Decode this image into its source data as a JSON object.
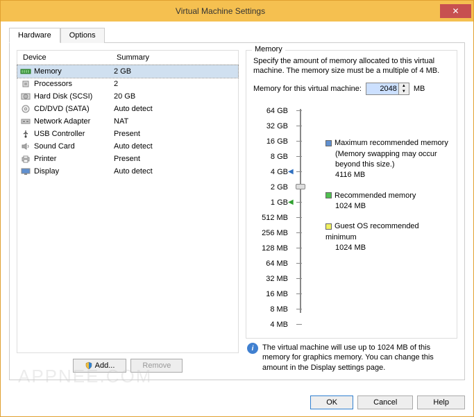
{
  "window": {
    "title": "Virtual Machine Settings"
  },
  "tabs": {
    "hardware": "Hardware",
    "options": "Options"
  },
  "deviceList": {
    "headers": {
      "device": "Device",
      "summary": "Summary"
    },
    "rows": [
      {
        "name": "Memory",
        "summary": "2 GB",
        "icon": "memory"
      },
      {
        "name": "Processors",
        "summary": "2",
        "icon": "cpu"
      },
      {
        "name": "Hard Disk (SCSI)",
        "summary": "20 GB",
        "icon": "disk"
      },
      {
        "name": "CD/DVD (SATA)",
        "summary": "Auto detect",
        "icon": "cd"
      },
      {
        "name": "Network Adapter",
        "summary": "NAT",
        "icon": "net"
      },
      {
        "name": "USB Controller",
        "summary": "Present",
        "icon": "usb"
      },
      {
        "name": "Sound Card",
        "summary": "Auto detect",
        "icon": "sound"
      },
      {
        "name": "Printer",
        "summary": "Present",
        "icon": "printer"
      },
      {
        "name": "Display",
        "summary": "Auto detect",
        "icon": "display"
      }
    ]
  },
  "buttons": {
    "add": "Add...",
    "remove": "Remove",
    "ok": "OK",
    "cancel": "Cancel",
    "help": "Help"
  },
  "memory": {
    "legend": "Memory",
    "desc": "Specify the amount of memory allocated to this virtual machine. The memory size must be a multiple of 4 MB.",
    "inputLabel": "Memory for this virtual machine:",
    "value": "2048",
    "unit": "MB",
    "sliderLabels": [
      "64 GB",
      "32 GB",
      "16 GB",
      "8 GB",
      "4 GB",
      "2 GB",
      "1 GB",
      "512 MB",
      "256 MB",
      "128 MB",
      "64 MB",
      "32 MB",
      "16 MB",
      "8 MB",
      "4 MB"
    ],
    "maxRec": {
      "title": "Maximum recommended memory",
      "note": "(Memory swapping may occur beyond this size.)",
      "value": "4116 MB"
    },
    "rec": {
      "title": "Recommended memory",
      "value": "1024 MB"
    },
    "guestMin": {
      "title": "Guest OS recommended minimum",
      "value": "1024 MB"
    },
    "info": "The virtual machine will use up to 1024 MB of this memory for graphics memory. You can change this amount in the Display settings page."
  },
  "watermark": "APPNEE.COM"
}
